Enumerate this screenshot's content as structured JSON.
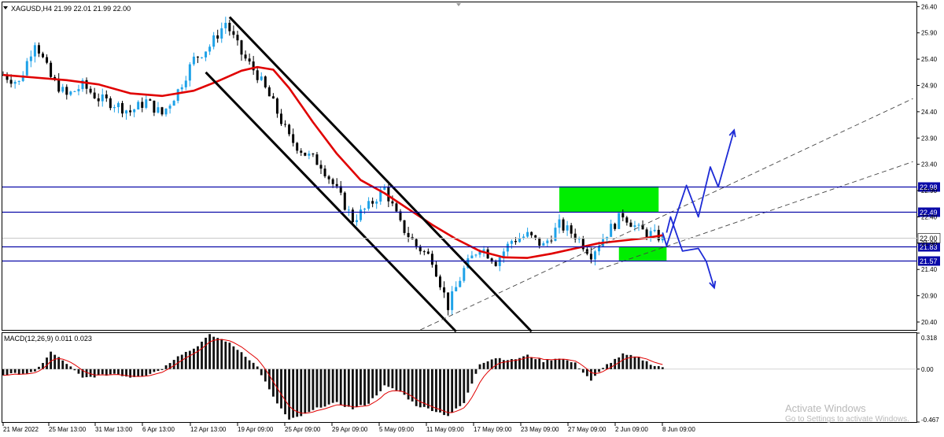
{
  "chart_data": {
    "type": "candlestick",
    "symbol_header": "XAGUSD,H4  21.99 22.01 21.99 22.00",
    "indicator_label": "MACD(12,26,9) 0.011 0.023",
    "y_ticks": [
      "26.40",
      "25.90",
      "25.40",
      "24.90",
      "24.40",
      "23.90",
      "23.40",
      "22.90",
      "22.40",
      "21.90",
      "21.40",
      "20.90",
      "20.40"
    ],
    "y_range": [
      20.25,
      26.48
    ],
    "macd_ticks": [
      "0.318",
      "0.00",
      "-0.467"
    ],
    "macd_range": [
      -0.467,
      0.318
    ],
    "x_ticks": [
      "21 Mar 2022",
      "25 Mar 13:00",
      "31 Mar 13:00",
      "6 Apr 13:00",
      "12 Apr 13:00",
      "19 Apr 09:00",
      "25 Apr 09:00",
      "29 Apr 09:00",
      "5 May 09:00",
      "11 May 09:00",
      "17 May 09:00",
      "23 May 09:00",
      "27 May 09:00",
      "2 Jun 09:00",
      "8 Jun 09:00"
    ],
    "level_lines": [
      {
        "label": "22.98",
        "value": 22.98,
        "color": "#0a0aa8"
      },
      {
        "label": "22.49",
        "value": 22.49,
        "color": "#0a0aa8"
      },
      {
        "label": "21.83",
        "value": 21.83,
        "color": "#0a0aa8"
      },
      {
        "label": "21.57",
        "value": 21.57,
        "color": "#0a0aa8"
      }
    ],
    "current_price": {
      "label": "22.00",
      "value": 22.0
    },
    "zones": [
      {
        "from_index": 140,
        "to_index": 165,
        "low": 22.49,
        "high": 22.98,
        "color": "#00ee00"
      },
      {
        "from_index": 155,
        "to_index": 167,
        "low": 21.57,
        "high": 21.83,
        "color": "#00ee00"
      }
    ],
    "close_path": [
      [
        0,
        25.1
      ],
      [
        4,
        24.95
      ],
      [
        8,
        25.75
      ],
      [
        12,
        25.05
      ],
      [
        16,
        24.7
      ],
      [
        20,
        24.9
      ],
      [
        24,
        24.65
      ],
      [
        28,
        24.55
      ],
      [
        32,
        24.4
      ],
      [
        36,
        24.6
      ],
      [
        40,
        24.35
      ],
      [
        44,
        24.8
      ],
      [
        48,
        25.4
      ],
      [
        52,
        25.65
      ],
      [
        56,
        26.1
      ],
      [
        60,
        25.5
      ],
      [
        64,
        25.1
      ],
      [
        68,
        24.55
      ],
      [
        72,
        23.9
      ],
      [
        76,
        23.6
      ],
      [
        80,
        23.4
      ],
      [
        84,
        22.9
      ],
      [
        88,
        22.35
      ],
      [
        92,
        22.6
      ],
      [
        96,
        22.95
      ],
      [
        100,
        22.25
      ],
      [
        104,
        21.85
      ],
      [
        108,
        21.6
      ],
      [
        112,
        20.7
      ],
      [
        116,
        21.4
      ],
      [
        120,
        21.85
      ],
      [
        124,
        21.55
      ],
      [
        128,
        21.95
      ],
      [
        132,
        22.05
      ],
      [
        136,
        21.85
      ],
      [
        140,
        22.25
      ],
      [
        144,
        22.05
      ],
      [
        148,
        21.7
      ],
      [
        152,
        22.1
      ],
      [
        156,
        22.45
      ],
      [
        160,
        22.15
      ],
      [
        164,
        22.05
      ],
      [
        166,
        22.0
      ]
    ],
    "moving_average": [
      [
        0,
        25.1
      ],
      [
        8,
        25.05
      ],
      [
        16,
        25.0
      ],
      [
        24,
        24.92
      ],
      [
        32,
        24.75
      ],
      [
        40,
        24.7
      ],
      [
        48,
        24.8
      ],
      [
        54,
        24.98
      ],
      [
        60,
        25.18
      ],
      [
        64,
        25.25
      ],
      [
        68,
        25.2
      ],
      [
        72,
        24.85
      ],
      [
        78,
        24.2
      ],
      [
        84,
        23.6
      ],
      [
        90,
        23.1
      ],
      [
        96,
        22.85
      ],
      [
        102,
        22.55
      ],
      [
        108,
        22.25
      ],
      [
        114,
        21.98
      ],
      [
        120,
        21.75
      ],
      [
        126,
        21.63
      ],
      [
        132,
        21.62
      ],
      [
        138,
        21.7
      ],
      [
        144,
        21.8
      ],
      [
        150,
        21.9
      ],
      [
        156,
        21.95
      ],
      [
        162,
        22.0
      ],
      [
        166,
        22.05
      ]
    ],
    "moving_average_color": "#e00000",
    "trend_lines": [
      {
        "from": [
          57,
          26.2
        ],
        "to": [
          133,
          20.22
        ],
        "color": "#000000",
        "style": "solid"
      },
      {
        "from": [
          51,
          25.15
        ],
        "to": [
          114,
          20.22
        ],
        "color": "#000000",
        "style": "solid"
      },
      {
        "from": [
          105,
          20.25
        ],
        "to": [
          229,
          24.65
        ],
        "color": "#444444",
        "style": "dashed"
      },
      {
        "from": [
          150,
          21.4
        ],
        "to": [
          229,
          23.45
        ],
        "color": "#444444",
        "style": "dashed"
      }
    ],
    "projection_paths": [
      {
        "color": "#1d2bd6",
        "points": [
          [
            166,
            22.1
          ],
          [
            167,
            21.85
          ],
          [
            170,
            22.55
          ],
          [
            172,
            23.0
          ],
          [
            175,
            22.4
          ],
          [
            178,
            23.35
          ],
          [
            180,
            22.97
          ],
          [
            184,
            24.05
          ]
        ]
      },
      {
        "color": "#1d2bd6",
        "points": [
          [
            167,
            22.1
          ],
          [
            168,
            22.4
          ],
          [
            171,
            21.75
          ],
          [
            175,
            21.8
          ],
          [
            177,
            21.55
          ],
          [
            179,
            21.05
          ]
        ]
      }
    ],
    "macd_path": [
      [
        0,
        -0.05
      ],
      [
        4,
        -0.04
      ],
      [
        8,
        -0.03
      ],
      [
        12,
        0.15
      ],
      [
        16,
        0.05
      ],
      [
        20,
        -0.08
      ],
      [
        24,
        -0.06
      ],
      [
        28,
        -0.04
      ],
      [
        32,
        -0.07
      ],
      [
        36,
        -0.05
      ],
      [
        40,
        0.0
      ],
      [
        44,
        0.12
      ],
      [
        48,
        0.18
      ],
      [
        52,
        0.3
      ],
      [
        56,
        0.25
      ],
      [
        60,
        0.15
      ],
      [
        64,
        0.02
      ],
      [
        68,
        -0.25
      ],
      [
        72,
        -0.45
      ],
      [
        76,
        -0.4
      ],
      [
        80,
        -0.33
      ],
      [
        84,
        -0.3
      ],
      [
        88,
        -0.35
      ],
      [
        92,
        -0.3
      ],
      [
        96,
        -0.15
      ],
      [
        100,
        -0.2
      ],
      [
        104,
        -0.32
      ],
      [
        108,
        -0.36
      ],
      [
        112,
        -0.41
      ],
      [
        116,
        -0.3
      ],
      [
        120,
        0.05
      ],
      [
        124,
        0.1
      ],
      [
        128,
        0.08
      ],
      [
        132,
        0.12
      ],
      [
        136,
        0.07
      ],
      [
        140,
        0.1
      ],
      [
        144,
        0.05
      ],
      [
        148,
        -0.1
      ],
      [
        152,
        0.04
      ],
      [
        156,
        0.13
      ],
      [
        160,
        0.1
      ],
      [
        164,
        0.03
      ],
      [
        166,
        0.02
      ]
    ]
  }
}
